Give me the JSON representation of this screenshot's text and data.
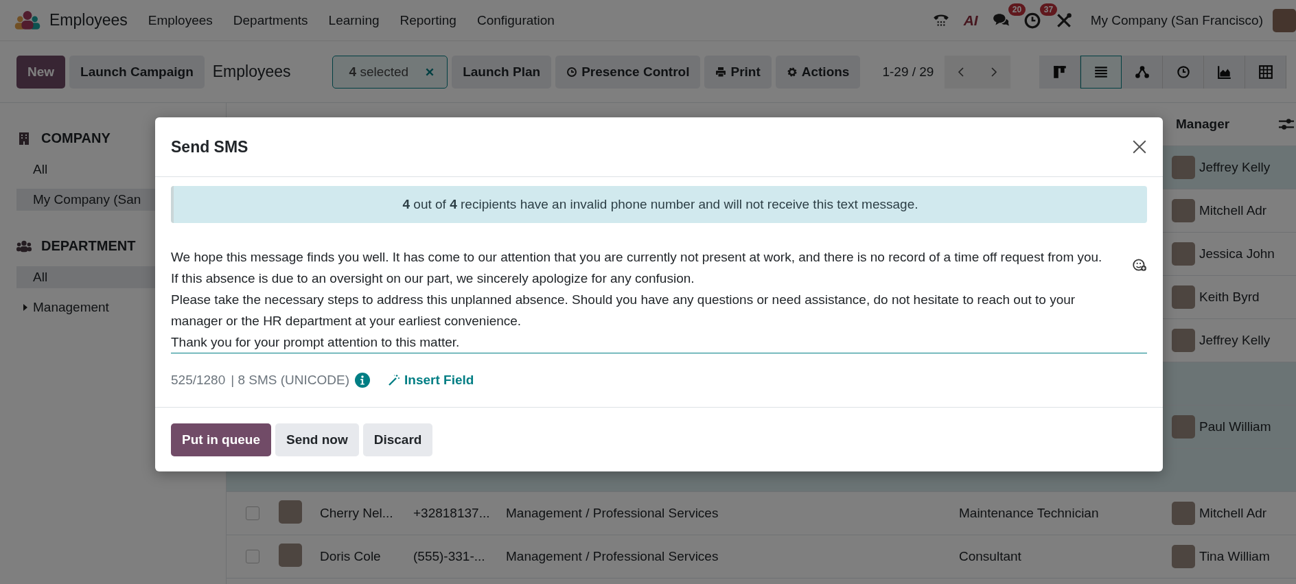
{
  "navbar": {
    "app_name": "Employees",
    "menu": [
      "Employees",
      "Departments",
      "Learning",
      "Reporting",
      "Configuration"
    ],
    "ai_label": "AI",
    "messages_badge": "20",
    "activities_badge": "37",
    "company": "My Company (San Francisco)"
  },
  "control_bar": {
    "new_button": "New",
    "campaign_button": "Launch Campaign",
    "breadcrumb": "Employees",
    "selection": "**4** selected",
    "actions": [
      {
        "kind": "plain",
        "label": "Launch Plan"
      },
      {
        "kind": "clock",
        "label": "Presence Control"
      },
      {
        "kind": "print",
        "label": "Print"
      },
      {
        "kind": "gear",
        "label": "Actions"
      }
    ],
    "pager": "1-29 / 29",
    "views": [
      {
        "kind": "kanban",
        "selected": false
      },
      {
        "kind": "list",
        "selected": true
      },
      {
        "kind": "hierarchy",
        "selected": false
      },
      {
        "kind": "activity",
        "selected": false
      },
      {
        "kind": "graph",
        "selected": false
      },
      {
        "kind": "pivot",
        "selected": false
      }
    ]
  },
  "sidebar": {
    "sections": [
      {
        "kind": "company",
        "title": "COMPANY",
        "items": [
          {
            "label": "All",
            "selected": false,
            "expandable": false
          },
          {
            "label": "My Company (San",
            "selected": true,
            "expandable": false
          }
        ]
      },
      {
        "kind": "department",
        "title": "DEPARTMENT",
        "items": [
          {
            "label": "All",
            "selected": true,
            "expandable": false
          },
          {
            "label": "Management",
            "selected": false,
            "expandable": true
          }
        ]
      }
    ]
  },
  "table": {
    "columns": {
      "manager": "Manager"
    },
    "rows": [
      {
        "selected": true,
        "manager": "Jeffrey Kelly"
      },
      {
        "selected": false,
        "manager": "Mitchell Adr"
      },
      {
        "selected": false,
        "manager": "Jessica John"
      },
      {
        "selected": false,
        "manager": "Keith Byrd"
      },
      {
        "selected": false,
        "manager": "Jeffrey Kelly"
      },
      {
        "selected": true
      },
      {
        "selected": true,
        "manager": "Paul William"
      },
      {
        "selected": true
      },
      {
        "selected": false,
        "name": "Cherry Nel...",
        "phone": "+32818137...",
        "department": "Management / Professional Services",
        "job": "Maintenance Technician",
        "manager": "Mitchell Adr"
      },
      {
        "selected": false,
        "name": "Doris Cole",
        "phone": "(555)-331-...",
        "department": "Management / Professional Services",
        "job": "Consultant",
        "manager": "Tina William"
      }
    ]
  },
  "dialog": {
    "title": "Send SMS",
    "alert": "**4** out of **4** recipients have an invalid phone number and will not receive this text message.",
    "message": "We hope this message finds you well. It has come to our attention that you are currently not present at work, and there is no record of a time off request from you. If this absence is due to an oversight on our part, we sincerely apologize for any confusion.\nPlease take the necessary steps to address this unplanned absence. Should you have any questions or need assistance, do not hesitate to reach out to your manager or the HR department at your earliest convenience.\nThank you for your prompt attention to this matter.",
    "counter": "525/1280",
    "sms_count": "| 8 SMS (UNICODE)",
    "insert_field": "Insert Field",
    "buttons": [
      {
        "kind": "primary",
        "label": "Put in queue"
      },
      {
        "kind": "secondary",
        "label": "Send now"
      },
      {
        "kind": "secondary",
        "label": "Discard"
      }
    ]
  }
}
